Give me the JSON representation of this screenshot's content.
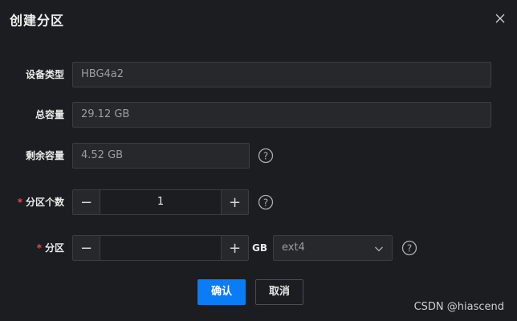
{
  "dialog": {
    "title": "创建分区",
    "close_icon": "close-icon"
  },
  "form": {
    "device_type": {
      "label": "设备类型",
      "value": "HBG4a2"
    },
    "total_capacity": {
      "label": "总容量",
      "value": "29.12 GB"
    },
    "remaining_capacity": {
      "label": "剩余容量",
      "value": "4.52 GB",
      "help_icon": "help-icon"
    },
    "partition_count": {
      "required_mark": "*",
      "label": "分区个数",
      "value": "1",
      "decrement": "−",
      "increment": "+",
      "help_icon": "help-icon"
    },
    "partition": {
      "required_mark": "*",
      "label": "分区",
      "value": "",
      "decrement": "−",
      "increment": "+",
      "unit": "GB",
      "fs_select": {
        "selected": "ext4"
      },
      "help_icon": "help-icon"
    }
  },
  "footer": {
    "confirm_label": "确认",
    "cancel_label": "取消"
  },
  "watermark": "CSDN @hiascend",
  "colors": {
    "background": "#1b1d21",
    "input_bg": "#26282c",
    "border": "#3a3d42",
    "primary": "#0a7cf6",
    "required": "#f0473f"
  }
}
